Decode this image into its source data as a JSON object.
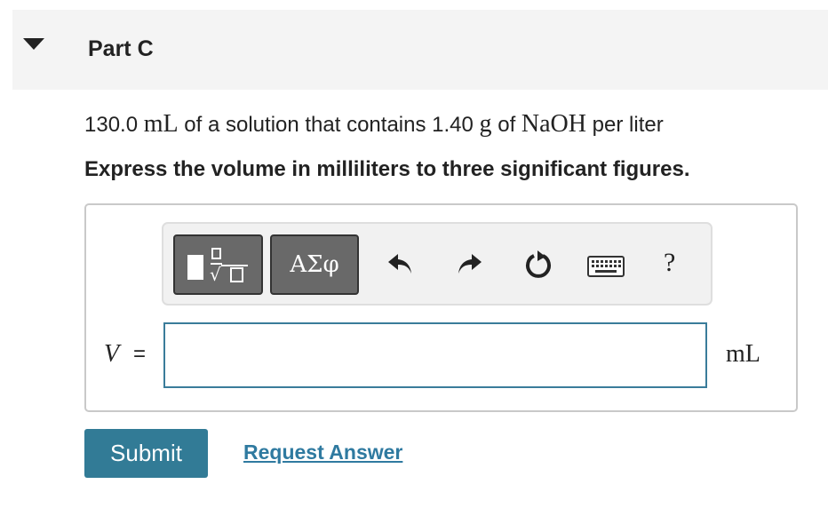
{
  "part": {
    "title": "Part C"
  },
  "problem": {
    "quantity": "130.0",
    "unit_ml": "mL",
    "text_1": "of a solution that contains",
    "mass": "1.40",
    "unit_g": "g",
    "text_2": "of",
    "compound": "NaOH",
    "text_3": "per liter"
  },
  "instruction": "Express the volume in milliliters to three significant figures.",
  "toolbar": {
    "greek_label": "ΑΣφ",
    "help_label": "?"
  },
  "answer": {
    "variable": "V",
    "equals": "=",
    "value": "",
    "unit": "mL"
  },
  "actions": {
    "submit_label": "Submit",
    "request_label": "Request Answer"
  },
  "colors": {
    "header_bg": "#f4f4f4",
    "accent": "#327b96",
    "link": "#2f7aa0",
    "toolbar_button": "#696969"
  }
}
